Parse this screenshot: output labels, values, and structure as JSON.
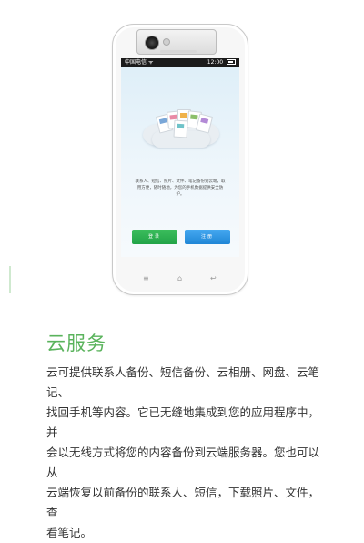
{
  "status_bar": {
    "carrier": "中国电信",
    "signal": "ᯤ",
    "time": "12:00"
  },
  "app_screen": {
    "description": "联系人、短信、照片、文件、笔记备份到云端，取用方便，随时随地，为您的手机数据提供安全防护。",
    "login_label": "登录",
    "register_label": "注册"
  },
  "nav_keys": {
    "menu": "≡",
    "home": "⌂",
    "back": "↩"
  },
  "feature": {
    "title": "云服务",
    "body": "云可提供联系人备份、短信备份、云相册、网盘、云笔记、\n找回手机等内容。它已无缝地集成到您的应用程序中，并\n会以无线方式将您的内容备份到云端服务器。您也可以从\n云端恢复以前备份的联系人、短信，下载照片、文件，查\n看笔记。"
  },
  "colors": {
    "title_green": "#5ab35c",
    "login_green": "#2cad50",
    "register_blue": "#2b93e0"
  },
  "icons": [
    "camera-lens-icon",
    "cloud-icon",
    "menu-key-icon",
    "home-key-icon",
    "back-key-icon"
  ]
}
